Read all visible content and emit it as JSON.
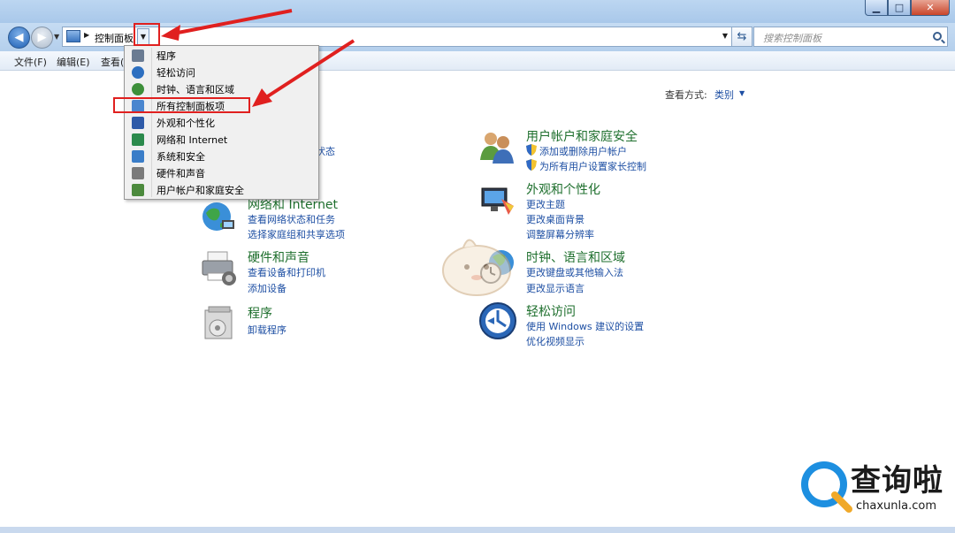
{
  "window": {
    "min_symbol": "▁",
    "max_symbol": "□",
    "close_symbol": "✕"
  },
  "address": {
    "crumb": "控制面板",
    "crumb_dropdown_symbol": "▼",
    "search_placeholder": "搜索控制面板"
  },
  "menubar": {
    "items": [
      "文件(F)",
      "编辑(E)",
      "查看("
    ]
  },
  "view_by": {
    "label": "查看方式:",
    "value": "类别"
  },
  "dropdown": {
    "items": [
      {
        "label": "程序",
        "icon": "programs-icon",
        "color": "#6a7b92"
      },
      {
        "label": "轻松访问",
        "icon": "ease-of-access-icon",
        "color": "#2d6fc0"
      },
      {
        "label": "时钟、语言和区域",
        "icon": "clock-language-icon",
        "color": "#3d8f3a"
      },
      {
        "label": "所有控制面板项",
        "icon": "control-panel-icon",
        "color": "#4a86cf"
      },
      {
        "label": "外观和个性化",
        "icon": "appearance-icon",
        "color": "#2e5aa8"
      },
      {
        "label": "网络和 Internet",
        "icon": "network-icon",
        "color": "#2b8a4c"
      },
      {
        "label": "系统和安全",
        "icon": "system-security-icon",
        "color": "#3a7dc8"
      },
      {
        "label": "硬件和声音",
        "icon": "hardware-sound-icon",
        "color": "#7a7a7a"
      },
      {
        "label": "用户帐户和家庭安全",
        "icon": "user-accounts-icon",
        "color": "#4c8a3d"
      }
    ]
  },
  "categories": {
    "partial_link": "状态",
    "network": {
      "title": "网络和 Internet",
      "links": [
        "查看网络状态和任务",
        "选择家庭组和共享选项"
      ]
    },
    "hardware": {
      "title": "硬件和声音",
      "links": [
        "查看设备和打印机",
        "添加设备"
      ]
    },
    "programs": {
      "title": "程序",
      "links": [
        "卸载程序"
      ]
    },
    "users": {
      "title": "用户帐户和家庭安全",
      "links": [
        "添加或删除用户帐户",
        "为所有用户设置家长控制"
      ]
    },
    "appearance": {
      "title": "外观和个性化",
      "links": [
        "更改主题",
        "更改桌面背景",
        "调整屏幕分辨率"
      ]
    },
    "clock": {
      "title": "时钟、语言和区域",
      "links": [
        "更改键盘或其他输入法",
        "更改显示语言"
      ]
    },
    "ease": {
      "title": "轻松访问",
      "links": [
        "使用 Windows 建议的设置",
        "优化视频显示"
      ]
    }
  },
  "watermark": {
    "brand": "查询啦",
    "url": "chaxunla.com"
  },
  "colors": {
    "category_title": "#1e6f2d",
    "link": "#1e4fa3",
    "annotation_red": "#e0201f"
  }
}
